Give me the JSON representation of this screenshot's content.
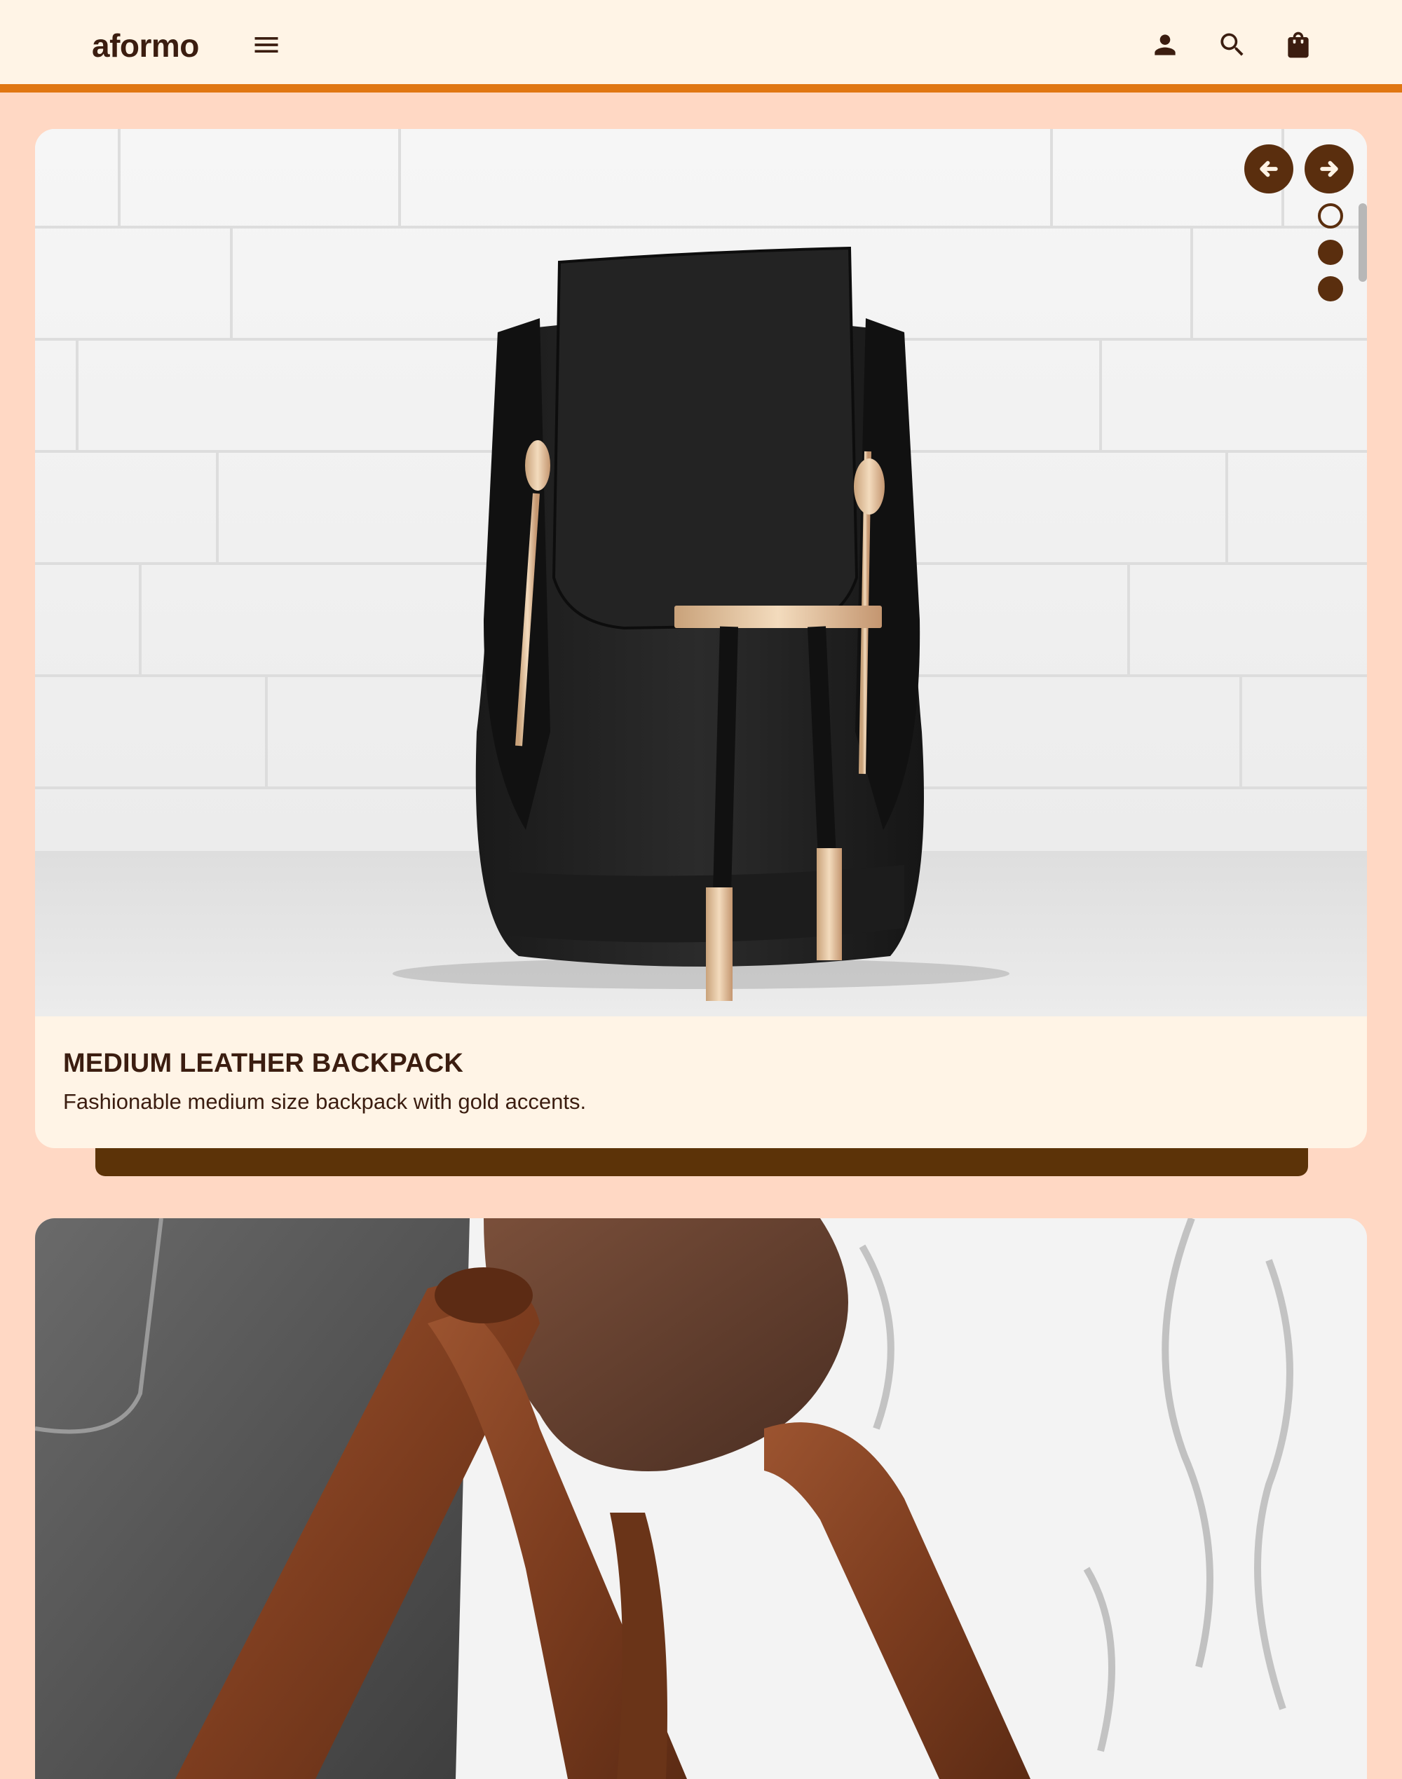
{
  "app": {
    "brand": "aformo"
  },
  "header": {
    "icons": [
      "menu-icon",
      "account-icon",
      "search-icon",
      "shopping-bag-icon"
    ]
  },
  "carousel": {
    "current_index": 1,
    "total_slides": 3,
    "slides": [
      {
        "title": "MEDIUM LEATHER BACKPACK",
        "description": "Fashionable medium size backpack with gold accents."
      }
    ]
  },
  "colors": {
    "page_bg": "#ffd8c4",
    "surface": "#fff4e6",
    "accent": "#e07612",
    "primary_dark": "#5a2e0e",
    "text": "#3b1d10"
  }
}
